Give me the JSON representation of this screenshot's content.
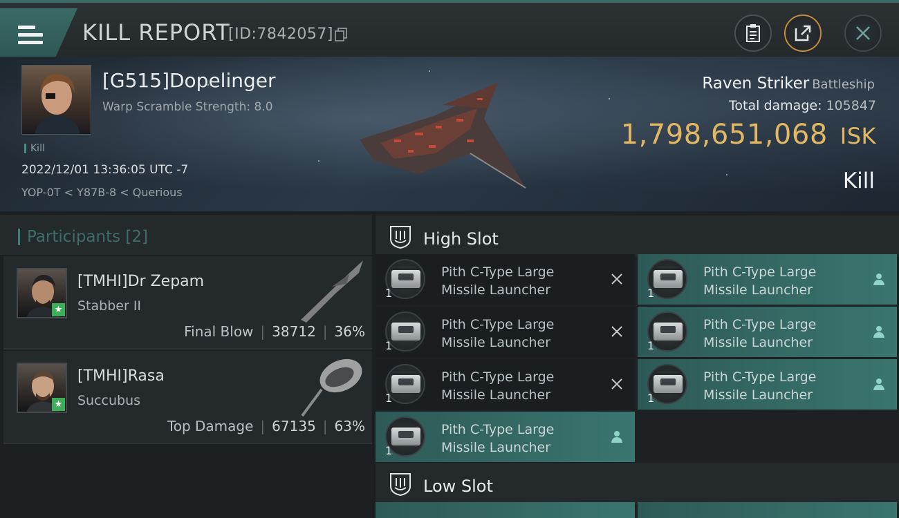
{
  "header": {
    "title": "KILL REPORT",
    "report_id": "[ID:7842057]",
    "icons": [
      "menu-icon",
      "copy-icon",
      "clipboard-icon",
      "share-icon",
      "close-icon"
    ]
  },
  "victim": {
    "name": "[G515]Dopelinger",
    "warp_scramble": "Warp Scramble Strength: 8.0",
    "kill_tag": "Kill",
    "datetime": "2022/12/01 13:36:05 UTC -7",
    "location": "YOP-0T < Y87B-8 < Querious",
    "ship_name": "Raven Striker",
    "ship_class": "Battleship",
    "total_damage_label": "Total damage:",
    "total_damage": "105847",
    "isk_value": "1,798,651,068",
    "isk_unit": "ISK",
    "result": "Kill"
  },
  "participants": {
    "title": "Participants [2]",
    "rows": [
      {
        "name": "[TMHI]Dr Zepam",
        "ship": "Stabber II",
        "role": "Final Blow",
        "damage": "38712",
        "percent": "36%"
      },
      {
        "name": "[TMHI]Rasa",
        "ship": "Succubus",
        "role": "Top Damage",
        "damage": "67135",
        "percent": "63%"
      }
    ]
  },
  "slots": {
    "high_label": "High Slot",
    "low_label": "Low Slot",
    "high_modules": [
      {
        "line1": "Pith C-Type Large",
        "line2": "Missile Launcher",
        "qty": "1",
        "status": "destroyed"
      },
      {
        "line1": "Pith C-Type Large",
        "line2": "Missile Launcher",
        "qty": "1",
        "status": "dropped"
      },
      {
        "line1": "Pith C-Type Large",
        "line2": "Missile Launcher",
        "qty": "1",
        "status": "destroyed"
      },
      {
        "line1": "Pith C-Type Large",
        "line2": "Missile Launcher",
        "qty": "1",
        "status": "dropped"
      },
      {
        "line1": "Pith C-Type Large",
        "line2": "Missile Launcher",
        "qty": "1",
        "status": "destroyed"
      },
      {
        "line1": "Pith C-Type Large",
        "line2": "Missile Launcher",
        "qty": "1",
        "status": "dropped"
      },
      {
        "line1": "Pith C-Type Large",
        "line2": "Missile Launcher",
        "qty": "1",
        "status": "dropped"
      }
    ]
  },
  "colors": {
    "accent_teal": "#3a7570",
    "isk_gold": "#e2b865",
    "share_ring": "#c18a3e",
    "star_green": "#3fae5b"
  }
}
